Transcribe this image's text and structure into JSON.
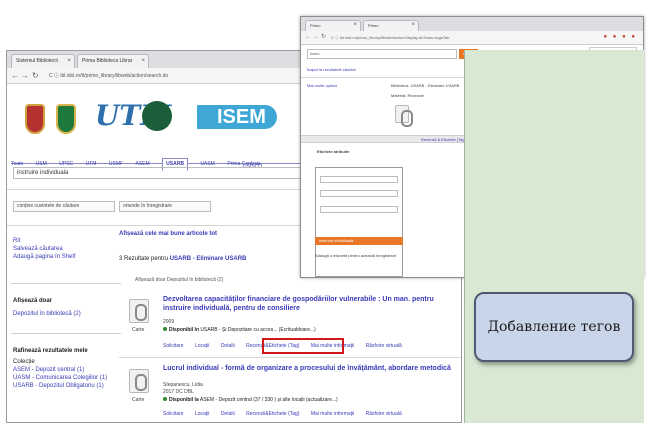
{
  "back_browser": {
    "tabs": [
      {
        "label": "Sistemul Bibliotecii"
      },
      {
        "label": "Prima Biblioteca Librar"
      }
    ],
    "url": "C  ⓘ  ibl.idsl.ro/tt/primo_library/libweb/action/search.do",
    "lib_tabs": [
      "Toate",
      "USM",
      "UPSC",
      "UTM",
      "USMF",
      "ASEM",
      "USARB",
      "UASM",
      "Prima Centrala"
    ],
    "active_tab": "USARB",
    "lib_tab_sub": "USISCU",
    "search_value": "instruire individuala",
    "select_scope": "conține cuvintele de căutare",
    "select_field": "oriunde în înregistrare",
    "sidebar": {
      "item1": "Rit",
      "item2": "Salvează căutarea",
      "item3": "Adaugă pagina în Shelf",
      "show_only_title": "Afișează doar",
      "show_only_item": "Depozitul în bibliotecă (2)",
      "refine_title": "Rafinează rezultatele mele",
      "refine_sub": "Colecție",
      "refine_items": [
        "ASEM - Depozit central (1)",
        "UASM - Comunicarea Colegiilor (1)",
        "USARB - Depozitul Obligatoriu (1)"
      ]
    },
    "results": {
      "head": "Afișează cele mai bune articole tot",
      "count_prefix": "3 Rezultate pentru",
      "count_strong": "USARB - Eliminare USARB",
      "filter": "Afișează doar   Depozitul în bibliotecă (2)"
    },
    "items": [
      {
        "title": "Dezvoltarea capacităților financiare de gospodăriilor vulnerabile : Un man. pentru instruire individuală, pentru de consiliere",
        "year": "2009",
        "avail_strong": "Disponibil în",
        "avail": "USARB - Și Depozitare cu acces...  (Ecrituabloare...)",
        "type": "Carte",
        "actions": [
          "Solicitare",
          "Locații",
          "Detalii",
          "Recenzii&Etichete (Tag)",
          "Mai multe informații",
          "Răsfoire virtuală"
        ]
      },
      {
        "title": "Lucrul individual - formă de organizare a procesului de învățământ, abordare metodică",
        "author": "Stepanescu, Lidia",
        "year": "2017 DC DBL",
        "avail_strong": "Disponibil la",
        "avail": "ASEM - Depozit central  (37 / 330 ) și alte locații (actualizare...)",
        "type": "Carte",
        "actions": [
          "Solicitare",
          "Locații",
          "Detalii",
          "Recenzii&Etichete (Tag)",
          "Mai multe informații",
          "Răsfoire virtuală"
        ]
      }
    ]
  },
  "front_browser": {
    "url": "C  ⓘ  ibl.idsl.ro/primo_library/libweb/action/display.do?tabs=tagsTab",
    "search_value": "index",
    "search_button": "Caută",
    "account": "Bine ați venit\nAutentificare\nBiblioteca mea",
    "nav_back": "Înapoi la rezultatele căutării",
    "meta_label": "Mai multe opțiuni",
    "record_source": "Biblioteca: USARB - Eliminare USARB",
    "material": "Material: Recenzie",
    "tags_strip": "Recenzii & Etichete (Tag)",
    "panel_title": "Etichete atribuite",
    "tag_btn_add": "Adaugă",
    "tag_btn_view": "Vedeți",
    "orange_label": "instruire individuală",
    "footer_label": "Adaugă o etichetă pentru această înregistrare"
  },
  "side_caption": {
    "label": "Добавление тегов"
  },
  "colors": {
    "highlight": "#d01818",
    "accent_orange": "#e97627",
    "link_blue": "#3a3ab8",
    "panel_green": "#d8e8d2",
    "caption_bg": "#c9d5e8"
  }
}
